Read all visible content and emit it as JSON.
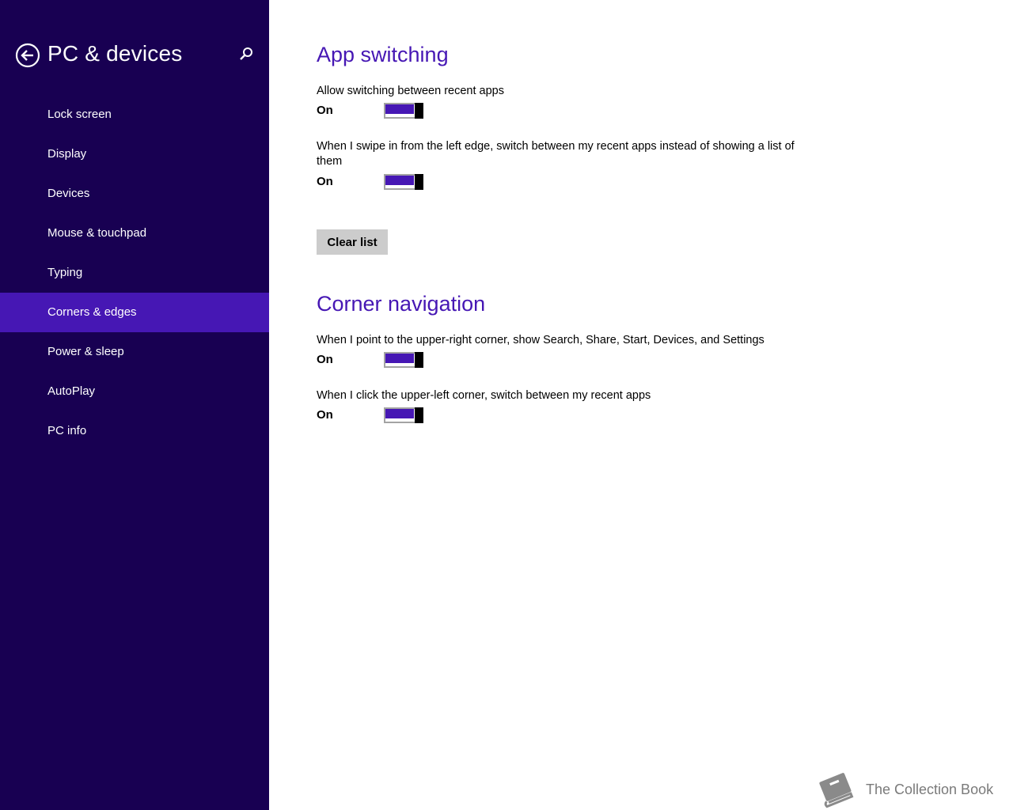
{
  "sidebar": {
    "title": "PC & devices",
    "back_icon": "back-arrow-icon",
    "search_icon": "search-icon",
    "items": [
      {
        "label": "Lock screen",
        "selected": false
      },
      {
        "label": "Display",
        "selected": false
      },
      {
        "label": "Devices",
        "selected": false
      },
      {
        "label": "Mouse & touchpad",
        "selected": false
      },
      {
        "label": "Typing",
        "selected": false
      },
      {
        "label": "Corners & edges",
        "selected": true
      },
      {
        "label": "Power & sleep",
        "selected": false
      },
      {
        "label": "AutoPlay",
        "selected": false
      },
      {
        "label": "PC info",
        "selected": false
      }
    ]
  },
  "app_switching": {
    "title": "App switching",
    "settings": [
      {
        "label": "Allow switching between recent apps",
        "state": "On",
        "value": true
      },
      {
        "label": "When I swipe in from the left edge, switch between my recent apps instead of showing a list of them",
        "state": "On",
        "value": true
      }
    ],
    "clear_button": "Clear list"
  },
  "corner_navigation": {
    "title": "Corner navigation",
    "settings": [
      {
        "label": "When I point to the upper-right corner, show Search, Share, Start, Devices, and Settings",
        "state": "On",
        "value": true
      },
      {
        "label": "When I click the upper-left corner, switch between my recent apps",
        "state": "On",
        "value": true
      }
    ]
  },
  "watermark": {
    "text": "The Collection Book",
    "icon": "book-icon"
  },
  "colors": {
    "sidebar_bg": "#180052",
    "accent": "#4617b4",
    "selected_bg": "#4617b4"
  }
}
